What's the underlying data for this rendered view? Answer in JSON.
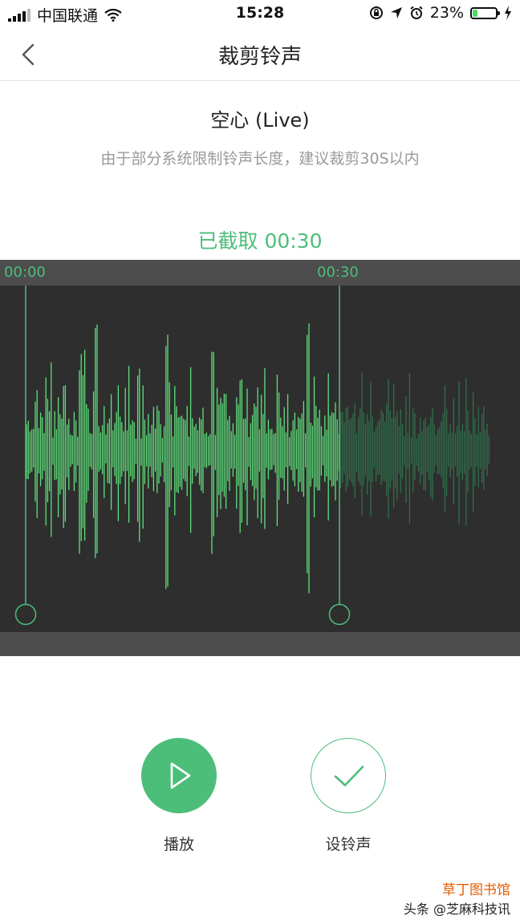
{
  "status_bar": {
    "carrier": "中国联通",
    "time": "15:28",
    "battery_percent": "23%",
    "battery_level": 0.23,
    "icons": [
      "signal-icon",
      "wifi-icon",
      "orientation-lock-icon",
      "location-icon",
      "alarm-icon",
      "battery-icon",
      "charging-icon"
    ]
  },
  "nav": {
    "title": "裁剪铃声",
    "back_icon": "chevron-left-icon"
  },
  "song": {
    "title": "空心 (Live)",
    "hint": "由于部分系统限制铃声长度，建议裁剪30S以内"
  },
  "clip": {
    "label": "已截取 00:30"
  },
  "waveform": {
    "start_label": "00:00",
    "end_label": "00:30",
    "selected_color": "#5ee07a",
    "unselected_color": "#2f6e4a",
    "accent": "#4cbe7a"
  },
  "controls": {
    "play_label": "播放",
    "play_icon": "play-icon",
    "set_label": "设铃声",
    "set_icon": "checkmark-icon"
  },
  "watermark": {
    "prefix": "头条",
    "handle": "@芝麻科技讯",
    "brand": "草丁图书馆"
  },
  "colors": {
    "accent": "#4cbe7a",
    "panel": "#2e2e2e"
  }
}
